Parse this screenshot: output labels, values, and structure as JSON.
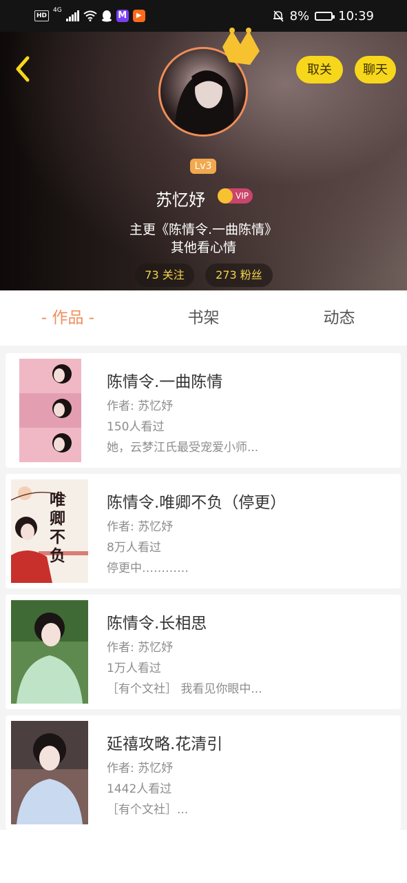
{
  "status_bar": {
    "hd": "HD",
    "network": "4G",
    "battery": "8%",
    "time": "10:39"
  },
  "profile": {
    "level": "Lv3",
    "name": "苏忆妤",
    "vip_label": "VIP",
    "bio_line1": "主更《陈情令.一曲陈情》",
    "bio_line2": "其他看心情",
    "following": "73 关注",
    "followers": "273 粉丝",
    "unfollow_label": "取关",
    "chat_label": "聊天"
  },
  "tabs": [
    {
      "label": "- 作品 -"
    },
    {
      "label": "书架"
    },
    {
      "label": "动态"
    }
  ],
  "works": [
    {
      "title": "陈情令.一曲陈情",
      "author": "作者: 苏忆妤",
      "views": "150人看过",
      "summary": "她，云梦江氏最受宠爱小师..."
    },
    {
      "title": "陈情令.唯卿不负（停更）",
      "author": "作者: 苏忆妤",
      "views": "8万人看过",
      "summary": "停更中…………",
      "cover_text": "唯卿不负"
    },
    {
      "title": "陈情令.长相思",
      "author": "作者: 苏忆妤",
      "views": "1万人看过",
      "summary": "［有个文社］ 我看见你眼中..."
    },
    {
      "title": "延禧攻略.花清引",
      "author": "作者: 苏忆妤",
      "views": "1442人看过",
      "summary": "［有个文社］..."
    }
  ],
  "colors": {
    "accent": "#ef8e5a",
    "button_yellow": "#f7d71b",
    "stat_text": "#f5d34a"
  }
}
